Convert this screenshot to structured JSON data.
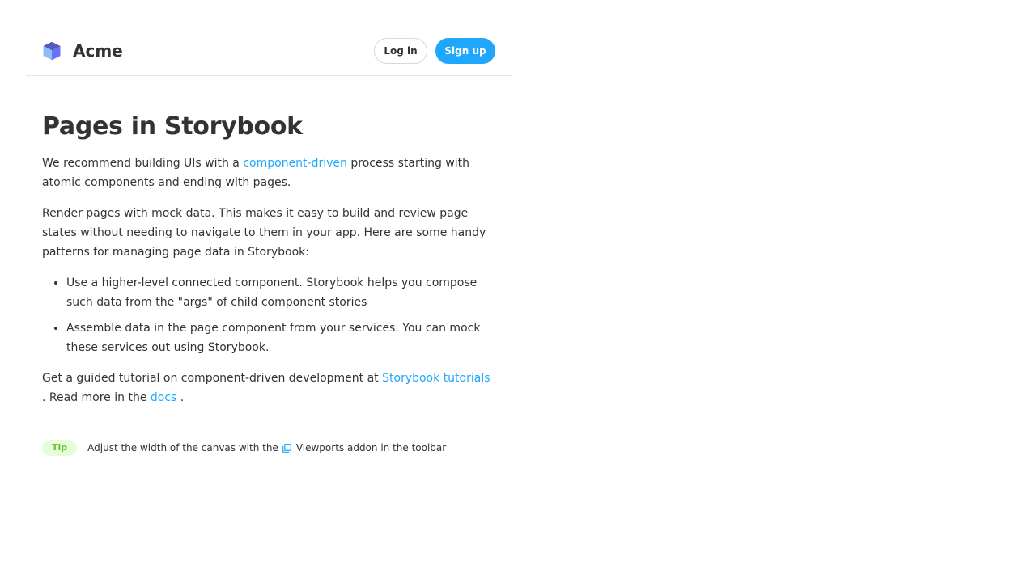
{
  "header": {
    "brand_name": "Acme",
    "login_label": "Log in",
    "signup_label": "Sign up"
  },
  "main": {
    "title": "Pages in Storybook",
    "intro": {
      "before": "We recommend building UIs with a ",
      "link": "component-driven",
      "after": " process starting with atomic components and ending with pages."
    },
    "paragraph2": "Render pages with mock data. This makes it easy to build and review page states without needing to navigate to them in your app. Here are some handy patterns for managing page data in Storybook:",
    "bullets": [
      "Use a higher-level connected component. Storybook helps you compose such data from the \"args\" of child component stories",
      "Assemble data in the page component from your services. You can mock these services out using Storybook."
    ],
    "closing": {
      "before": "Get a guided tutorial on component-driven development at ",
      "link1": "Storybook tutorials",
      "middle": " . Read more in the ",
      "link2": "docs",
      "after": " ."
    },
    "tip": {
      "badge": "Tip",
      "before": "Adjust the width of the canvas with the",
      "after": "Viewports addon in the toolbar",
      "icon": "viewport-icon"
    }
  },
  "colors": {
    "accent": "#1ea7fd",
    "tip_bg": "#e7fdd8",
    "tip_text": "#66bf3c",
    "logo_light": "#6875ff",
    "logo_dark": "#2e41b7"
  }
}
